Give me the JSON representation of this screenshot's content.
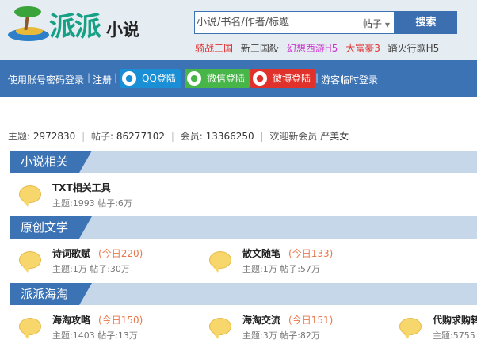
{
  "logo": {
    "text_main": "派派",
    "text_sub": "小说"
  },
  "search": {
    "placeholder": "小说/书名/作者/标题",
    "type_selected": "帖子",
    "button_label": "搜索"
  },
  "hot_links": [
    {
      "label": "骑战三国",
      "color": "#e03030"
    },
    {
      "label": "新三国殺",
      "color": "#444444"
    },
    {
      "label": "幻想西游H5",
      "color": "#cc33cc"
    },
    {
      "label": "大富豪3",
      "color": "#e03030"
    },
    {
      "label": "踏火行歌H5",
      "color": "#444444"
    }
  ],
  "loginbar": {
    "login_label": "使用账号密码登录",
    "sep": "|",
    "register_label": "注册",
    "qq_label": "QQ登陆",
    "wechat_label": "微信登陆",
    "weibo_label": "微博登陆",
    "guest_label": "游客临时登录"
  },
  "stats": {
    "topics_label": "主题:",
    "topics": "2972830",
    "posts_label": "帖子:",
    "posts": "86277102",
    "members_label": "会员:",
    "members": "13366250",
    "welcome_label": "欢迎新会员",
    "newest_member": "严美女"
  },
  "sections": [
    {
      "title": "小说相关",
      "forums": [
        {
          "name": "TXT相关工具",
          "today": "",
          "meta": "主题:1993  帖子:6万"
        }
      ]
    },
    {
      "title": "原创文学",
      "forums": [
        {
          "name": "诗词歌赋",
          "today": "(今日220)",
          "meta": "主题:1万  帖子:30万"
        },
        {
          "name": "散文随笔",
          "today": "(今日133)",
          "meta": "主题:1万  帖子:57万"
        }
      ]
    },
    {
      "title": "派派海淘",
      "forums": [
        {
          "name": "海淘攻略",
          "today": "(今日150)",
          "meta": "主题:1403  帖子:13万"
        },
        {
          "name": "海淘交流",
          "today": "(今日151)",
          "meta": "主题:3万  帖子:82万"
        },
        {
          "name": "代购求购转",
          "today": "",
          "meta": "主题:5755"
        }
      ]
    }
  ],
  "colors": {
    "brand_blue": "#3c73b4",
    "header_bg": "#e5edf2",
    "today_orange": "#e8774a"
  }
}
